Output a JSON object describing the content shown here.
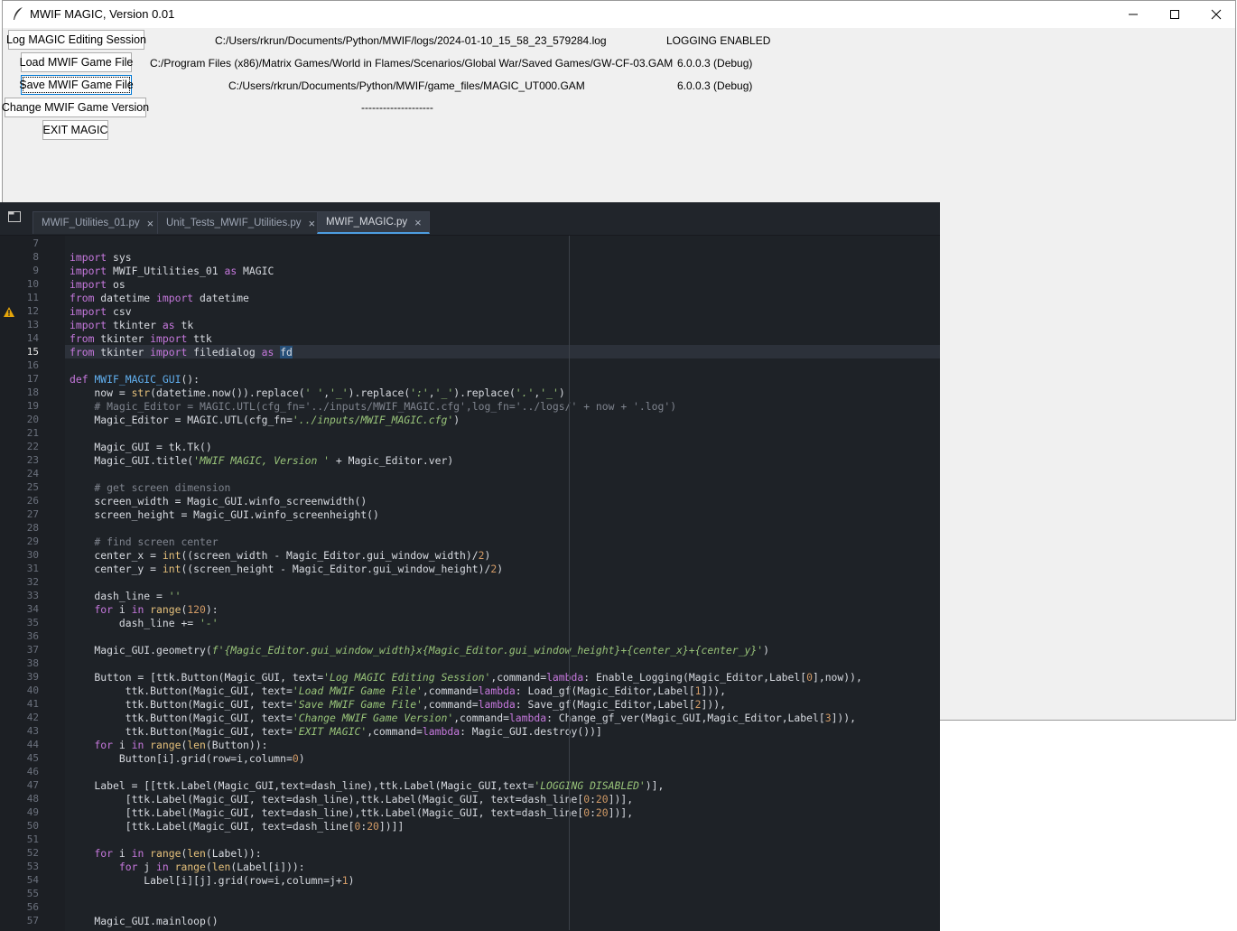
{
  "window": {
    "title": "MWIF MAGIC, Version 0.01"
  },
  "buttons": [
    "Log MAGIC Editing Session",
    "Load MWIF Game File",
    "Save MWIF Game File",
    "Change MWIF Game Version",
    "EXIT MAGIC"
  ],
  "labels": {
    "log_path": "C:/Users/rkrun/Documents/Python/MWIF/logs/2024-01-10_15_58_23_579284.log",
    "log_status": "LOGGING ENABLED",
    "load_path": "C:/Program Files (x86)/Matrix Games/World in Flames/Scenarios/Global War/Saved Games/GW-CF-03.GAM",
    "load_version": "6.0.0.3 (Debug)",
    "save_path": "C:/Users/rkrun/Documents/Python/MWIF/game_files/MAGIC_UT000.GAM",
    "save_version": "6.0.0.3 (Debug)",
    "version_dash": "--------------------"
  },
  "tabs": [
    {
      "label": "MWIF_Utilities_01.py"
    },
    {
      "label": "Unit_Tests_MWIF_Utilities.py"
    },
    {
      "label": "MWIF_MAGIC.py"
    }
  ],
  "line_numbers": [
    "7",
    "8",
    "9",
    "10",
    "11",
    "12",
    "13",
    "14",
    "15",
    "16",
    "17",
    "18",
    "19",
    "20",
    "21",
    "22",
    "23",
    "24",
    "25",
    "26",
    "27",
    "28",
    "29",
    "30",
    "31",
    "32",
    "33",
    "34",
    "35",
    "36",
    "37",
    "38",
    "39",
    "40",
    "41",
    "42",
    "43",
    "44",
    "45",
    "46",
    "47",
    "48",
    "49",
    "50",
    "51",
    "52",
    "53",
    "54",
    "55",
    "56",
    "57"
  ],
  "code_lines": [
    "",
    "import sys",
    "import MWIF_Utilities_01 as MAGIC",
    "import os",
    "from datetime import datetime",
    "import csv",
    "import tkinter as tk",
    "from tkinter import ttk",
    "from tkinter import filedialog as fd",
    "",
    "def MWIF_MAGIC_GUI():",
    "    now = str(datetime.now()).replace(' ','_').replace(':','_').replace('.','_')",
    "    # Magic_Editor = MAGIC.UTL(cfg_fn='../inputs/MWIF_MAGIC.cfg',log_fn='../logs/' + now + '.log')",
    "    Magic_Editor = MAGIC.UTL(cfg_fn='../inputs/MWIF_MAGIC.cfg')",
    "",
    "    Magic_GUI = tk.Tk()",
    "    Magic_GUI.title('MWIF MAGIC, Version ' + Magic_Editor.ver)",
    "",
    "    # get screen dimension",
    "    screen_width = Magic_GUI.winfo_screenwidth()",
    "    screen_height = Magic_GUI.winfo_screenheight()",
    "",
    "    # find screen center",
    "    center_x = int((screen_width - Magic_Editor.gui_window_width)/2)",
    "    center_y = int((screen_height - Magic_Editor.gui_window_height)/2)",
    "",
    "    dash_line = ''",
    "    for i in range(120):",
    "        dash_line += '-'",
    "",
    "    Magic_GUI.geometry(f'{Magic_Editor.gui_window_width}x{Magic_Editor.gui_window_height}+{center_x}+{center_y}')",
    "",
    "    Button = [ttk.Button(Magic_GUI, text='Log MAGIC Editing Session',command=lambda: Enable_Logging(Magic_Editor,Label[0],now)),",
    "         ttk.Button(Magic_GUI, text='Load MWIF Game File',command=lambda: Load_gf(Magic_Editor,Label[1])),",
    "         ttk.Button(Magic_GUI, text='Save MWIF Game File',command=lambda: Save_gf(Magic_Editor,Label[2])),",
    "         ttk.Button(Magic_GUI, text='Change MWIF Game Version',command=lambda: Change_gf_ver(Magic_GUI,Magic_Editor,Label[3])),",
    "         ttk.Button(Magic_GUI, text='EXIT MAGIC',command=lambda: Magic_GUI.destroy())]",
    "    for i in range(len(Button)):",
    "        Button[i].grid(row=i,column=0)",
    "",
    "    Label = [[ttk.Label(Magic_GUI,text=dash_line),ttk.Label(Magic_GUI,text='LOGGING DISABLED')],",
    "         [ttk.Label(Magic_GUI, text=dash_line),ttk.Label(Magic_GUI, text=dash_line[0:20])],",
    "         [ttk.Label(Magic_GUI, text=dash_line),ttk.Label(Magic_GUI, text=dash_line[0:20])],",
    "         [ttk.Label(Magic_GUI, text=dash_line[0:20])]]",
    "",
    "    for i in range(len(Label)):",
    "        for j in range(len(Label[i])):",
    "            Label[i][j].grid(row=i,column=j+1)",
    "",
    "",
    "    Magic_GUI.mainloop()"
  ],
  "colors": {
    "editor_bg": "#1e2227",
    "keyword": "#c678dd",
    "string": "#98c379",
    "comment": "#7f848e",
    "function": "#61afef",
    "accent": "#4d9de0",
    "warning": "#e5a50a"
  }
}
